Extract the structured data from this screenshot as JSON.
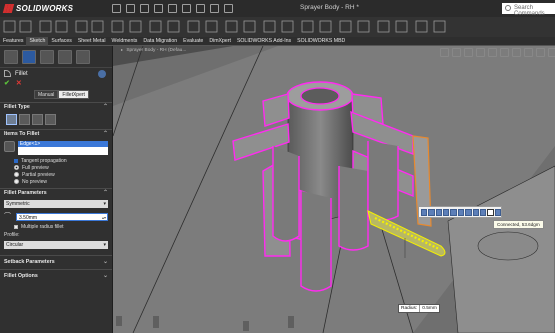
{
  "app": {
    "logo_prefix": "3S",
    "logo_name": "SOLIDWORKS",
    "document_title": "Sprayer Body - RH *",
    "search_placeholder": "Search Commands"
  },
  "tabs": [
    "Features",
    "Sketch",
    "Surfaces",
    "Sheet Metal",
    "Weldments",
    "Data Migration",
    "Evaluate",
    "DimXpert",
    "SOLIDWORKS Add-Ins",
    "SOLIDWORKS MBD"
  ],
  "active_tab": "Sketch",
  "property_manager": {
    "title": "Fillet",
    "ok": "✔",
    "cancel": "✕",
    "modes": [
      "Manual",
      "FilletXpert"
    ],
    "fillet_type_header": "Fillet Type",
    "items_header": "Items To Fillet",
    "selected_item": "Edge<1>",
    "tangent_propagation": "Tangent propagation",
    "preview_options": [
      "Full preview",
      "Partial preview",
      "No preview"
    ],
    "preview_selected": "Full preview",
    "fillet_params_header": "Fillet Parameters",
    "symmetry": "Symmetric",
    "radius_value": "3.50mm",
    "multiple_radius": "Multiple radius fillet",
    "profile_label": "Profile:",
    "profile_value": "Circular",
    "setback_header": "Setback Parameters",
    "options_header": "Fillet Options"
  },
  "viewport": {
    "tree_label": "Sprayer Body - RH (Defau...",
    "tooltip": "Connected, 53.6dgm",
    "callout_label": "Radius:",
    "callout_value": "0.5mm"
  },
  "colors": {
    "selection_magenta": "#ff2bf0",
    "edge_yellow": "#f5f000",
    "highlight_orange": "#e8892e",
    "accent_blue": "#3b78d8"
  }
}
